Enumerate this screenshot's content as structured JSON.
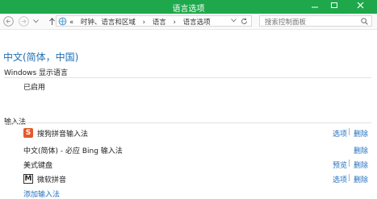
{
  "window": {
    "title": "语言选项",
    "accent": "#1fa84b"
  },
  "address_bar": {
    "crumbs": [
      "«",
      "时钟、语言和区域",
      "›",
      "语言",
      "›",
      "语言选项"
    ]
  },
  "search": {
    "placeholder": "搜索控制面板"
  },
  "language_heading": "中文(简体，中国)",
  "display_language": {
    "label": "Windows 显示语言",
    "status": "已启用"
  },
  "input_methods": {
    "label": "输入法",
    "items": [
      {
        "icon": "sogou-icon",
        "icon_char": "S",
        "name": "搜狗拼音输入法",
        "options": "选项",
        "sep": "|",
        "remove": "删除"
      },
      {
        "icon": "",
        "icon_char": "",
        "name": "中文(简体) - 必应 Bing 输入法",
        "options": "",
        "sep": "",
        "remove": "删除"
      },
      {
        "icon": "",
        "icon_char": "",
        "name": "美式键盘",
        "options": "预览",
        "sep": "|",
        "remove": "删除"
      },
      {
        "icon": "microsoft-pinyin-icon",
        "icon_char": "M",
        "name": "微软拼音",
        "options": "选项",
        "sep": "|",
        "remove": "删除"
      }
    ],
    "add_link": "添加输入法"
  }
}
